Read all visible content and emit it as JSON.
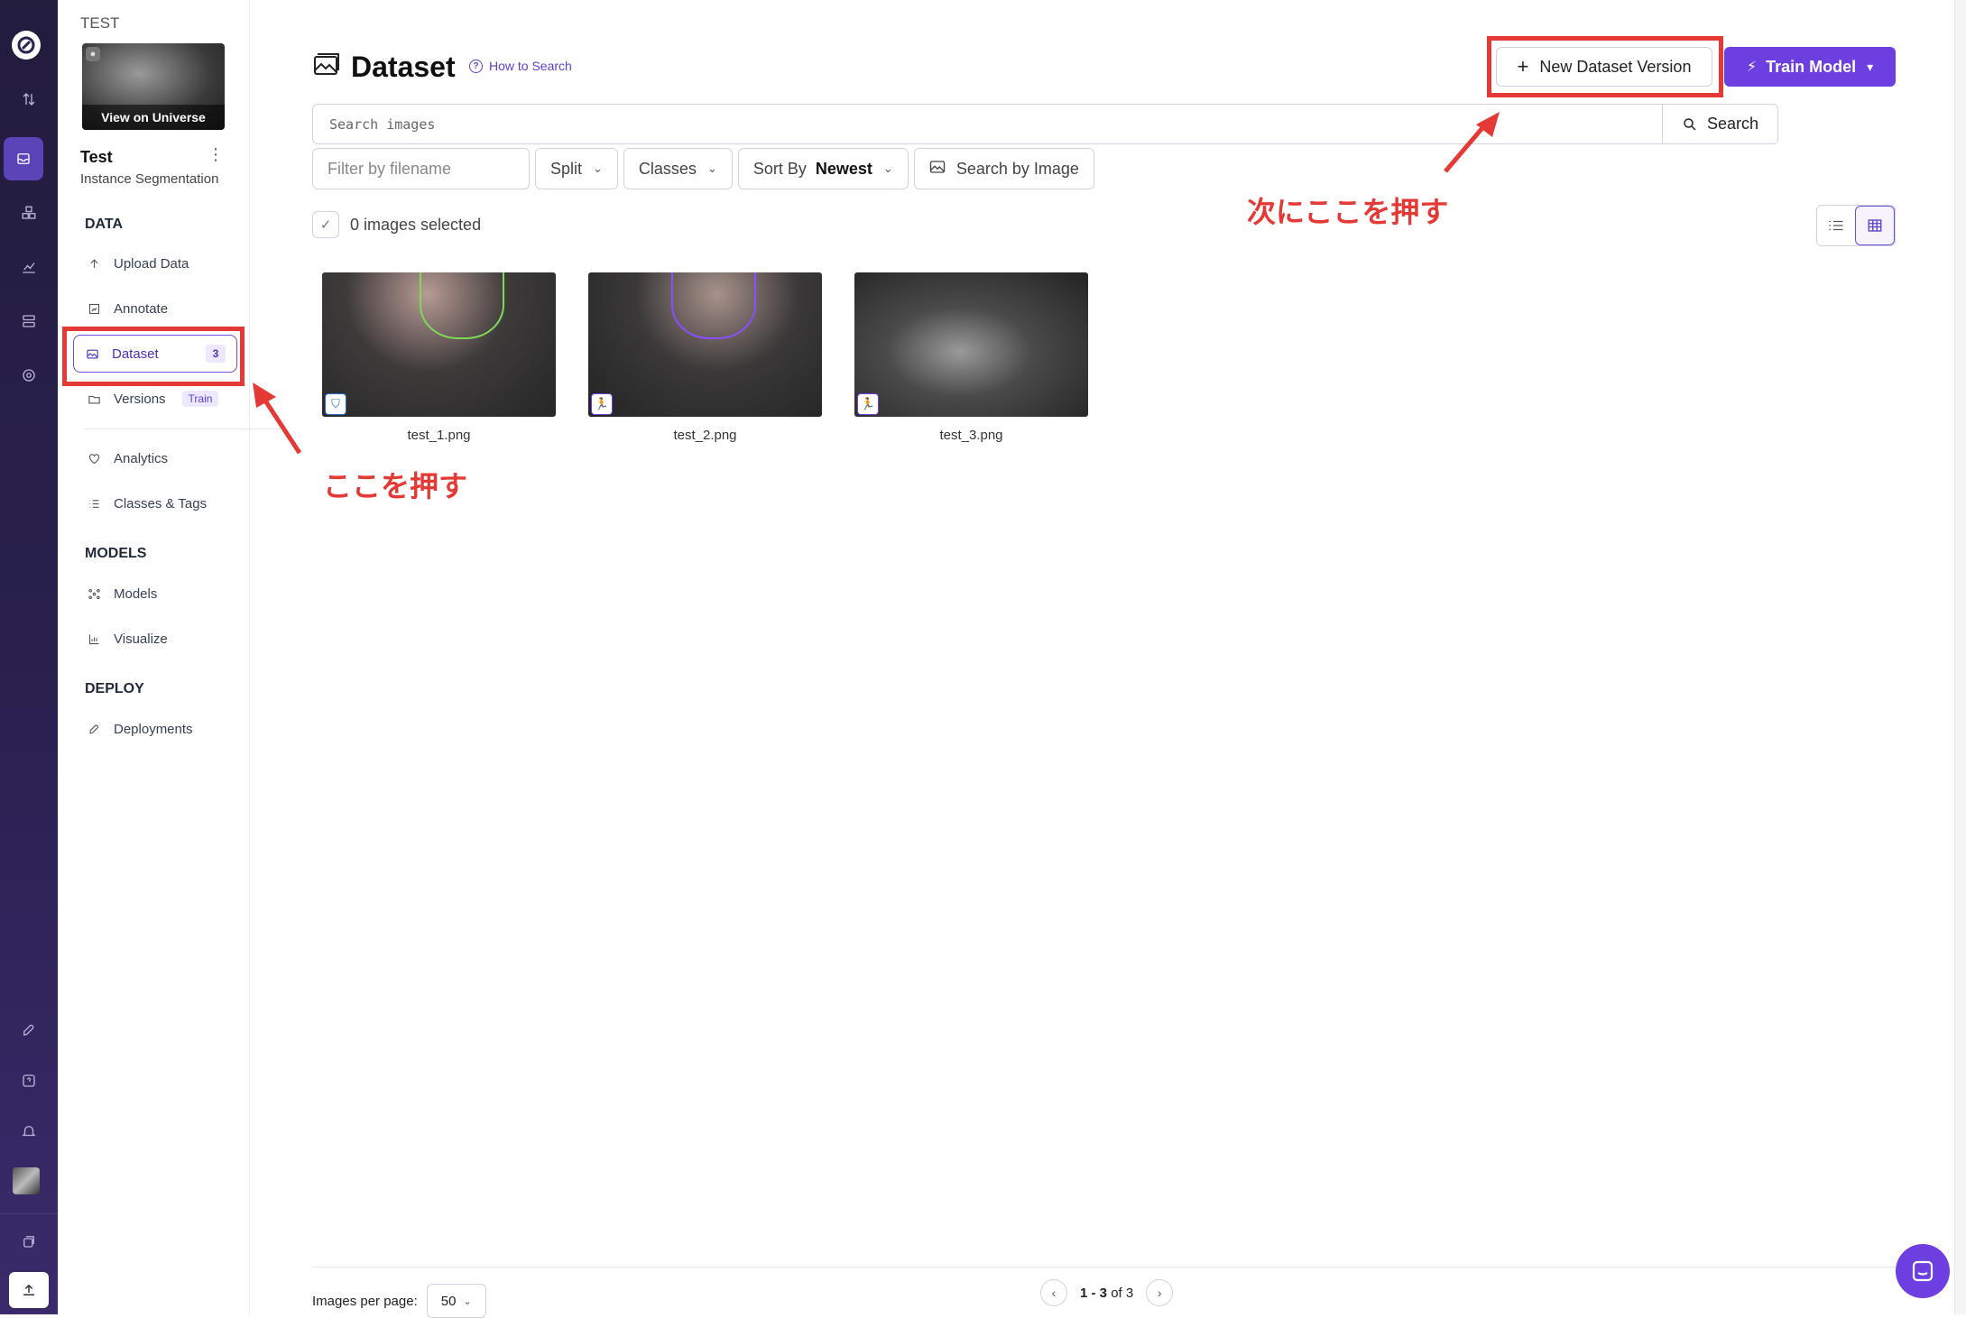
{
  "rail": {
    "icons": [
      "roboflow-logo-icon",
      "swap-icon",
      "inbox-icon",
      "cubes-icon",
      "chart-icon",
      "database-icon",
      "gear-icon",
      "rocket-icon",
      "help-icon",
      "bell-icon",
      "user-avatar",
      "library-icon",
      "upload-icon"
    ]
  },
  "sidebar": {
    "workspace": "TEST",
    "view_on_universe": "View on Universe",
    "project_name": "Test",
    "project_type": "Instance Segmentation",
    "sections": {
      "data": "DATA",
      "models": "MODELS",
      "deploy": "DEPLOY"
    },
    "items": [
      {
        "label": "Upload Data",
        "icon": "upload-arrow-icon"
      },
      {
        "label": "Annotate",
        "icon": "annotate-icon"
      },
      {
        "label": "Dataset",
        "icon": "image-icon",
        "badge": "3"
      },
      {
        "label": "Versions",
        "icon": "folder-icon",
        "badge": "Train"
      },
      {
        "label": "Analytics",
        "icon": "heart-icon"
      },
      {
        "label": "Classes & Tags",
        "icon": "list-icon"
      },
      {
        "label": "Models",
        "icon": "nodes-icon"
      },
      {
        "label": "Visualize",
        "icon": "chart-icon"
      },
      {
        "label": "Deployments",
        "icon": "rocket-icon"
      }
    ]
  },
  "header": {
    "title": "Dataset",
    "how_to": "How to Search",
    "new_version": "New Dataset Version",
    "train": "Train Model"
  },
  "search": {
    "placeholder": "Search images",
    "button": "Search"
  },
  "filters": {
    "filename_placeholder": "Filter by filename",
    "split": "Split",
    "classes": "Classes",
    "sort_label": "Sort By",
    "sort_value": "Newest",
    "search_by_image": "Search by Image"
  },
  "selection": {
    "text": "0 images selected"
  },
  "images": [
    {
      "name": "test_1.png",
      "split": "valid",
      "accent": "#7ed957"
    },
    {
      "name": "test_2.png",
      "split": "train",
      "accent": "#8a4dff"
    },
    {
      "name": "test_3.png",
      "split": "train",
      "accent": "#8a4dff"
    }
  ],
  "annotations": {
    "first": "ここを押す",
    "second": "次にここを押す",
    "color": "#e53935"
  },
  "footer": {
    "per_page_label": "Images per page:",
    "per_page_value": "50",
    "range": "1 - 3",
    "of": "of 3"
  },
  "colors": {
    "accent": "#6d3fe0",
    "rail": "#221c3d"
  }
}
